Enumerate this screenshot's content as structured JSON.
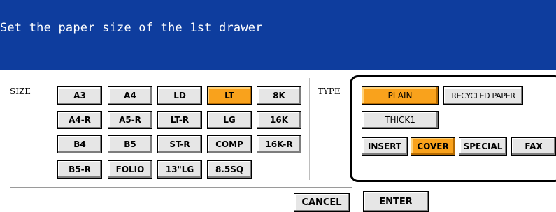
{
  "header": {
    "title": "Set the paper size of the 1st drawer"
  },
  "size_section": {
    "label": "SIZE",
    "buttons": [
      "A3",
      "A4",
      "LD",
      "LT",
      "8K",
      "A4-R",
      "A5-R",
      "LT-R",
      "LG",
      "16K",
      "B4",
      "B5",
      "ST-R",
      "COMP",
      "16K-R",
      "B5-R",
      "FOLIO",
      "13\"LG",
      "8.5SQ"
    ],
    "selected": "LT"
  },
  "type_section": {
    "label": "TYPE",
    "buttons": [
      "PLAIN",
      "RECYCLED PAPER",
      "THICK1",
      "INSERT",
      "COVER",
      "SPECIAL",
      "FAX"
    ],
    "selected": [
      "PLAIN",
      "COVER"
    ]
  },
  "footer": {
    "cancel_label": "CANCEL",
    "enter_label": "ENTER"
  },
  "colors": {
    "title_bar": "#0e3d9e",
    "selected": "#f9a21c",
    "button": "#e6e6e6"
  }
}
